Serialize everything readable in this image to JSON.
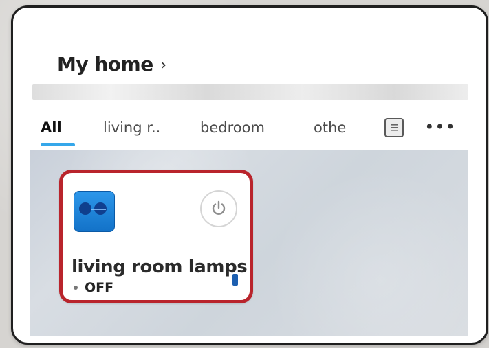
{
  "header": {
    "title": "My home",
    "chevron": "›"
  },
  "tabs": [
    {
      "label": "All",
      "active": true
    },
    {
      "label": "living r...",
      "active": false
    },
    {
      "label": "bedroom",
      "active": false
    },
    {
      "label": "othe",
      "active": false
    }
  ],
  "tab_actions": {
    "list_icon": "list-icon",
    "more_label": "•••"
  },
  "device": {
    "name": "living room lamps",
    "status": "OFF",
    "icon": "switch-icon",
    "power_icon": "power-icon",
    "battery_icon": "battery-icon"
  },
  "colors": {
    "accent": "#35a7ea",
    "highlight": "#b9242c",
    "device_blue": "#1f84dc"
  }
}
